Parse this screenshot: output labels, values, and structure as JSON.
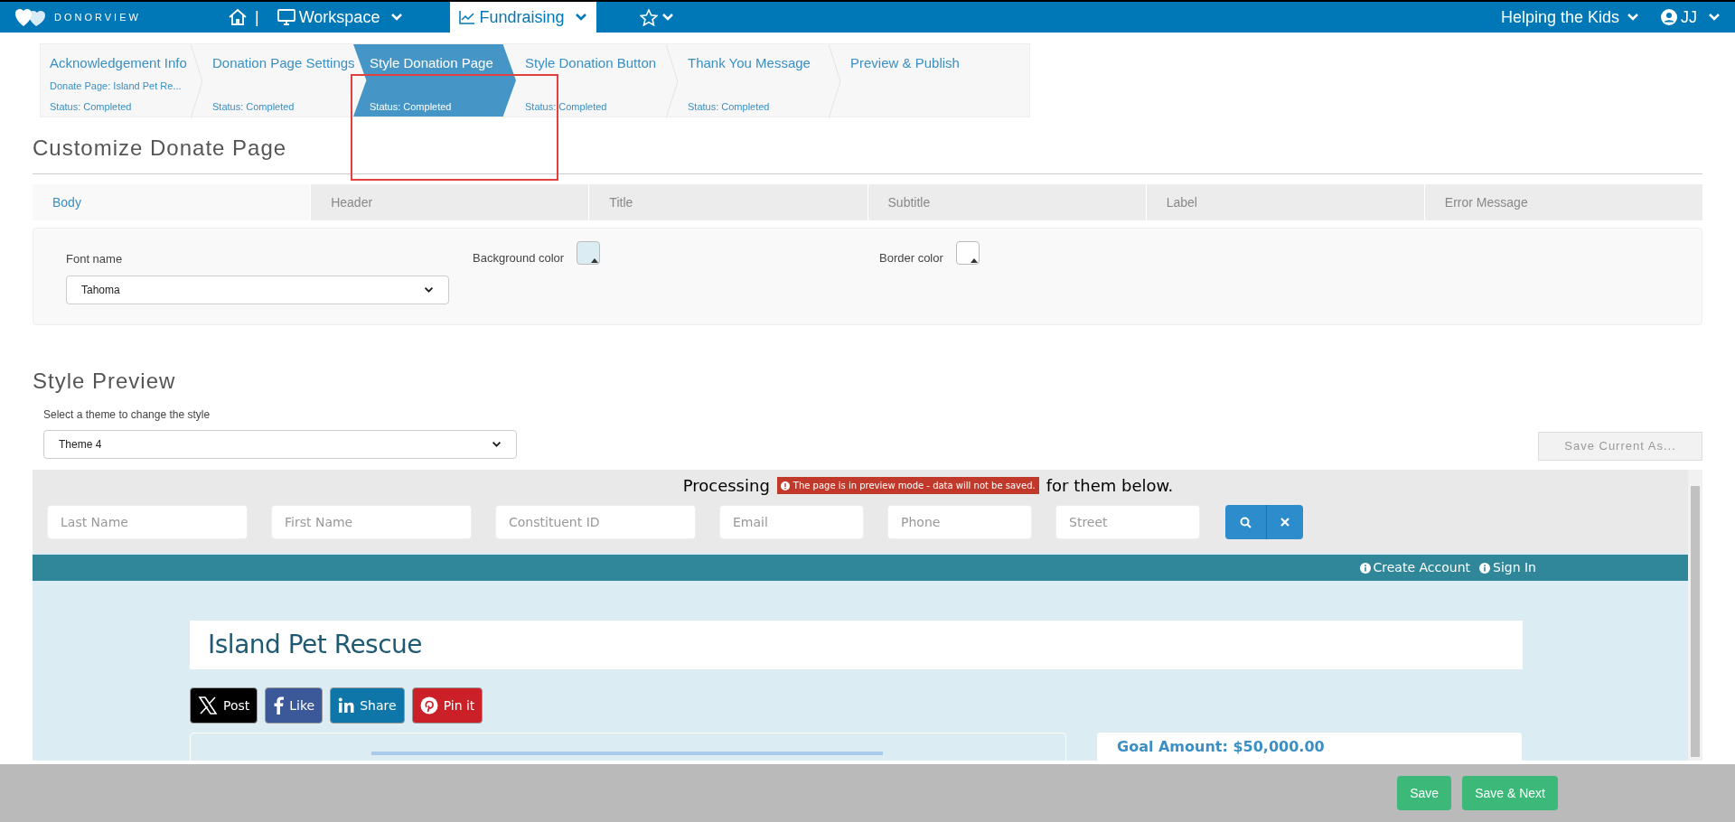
{
  "top_nav": {
    "brand": "DONORVIEW",
    "separator": "|",
    "items": [
      {
        "label": "Workspace",
        "kind": "monitor",
        "selected": false
      },
      {
        "label": "Fundraising",
        "kind": "chart",
        "selected": true
      }
    ],
    "organization": "Helping the Kids",
    "user": "JJ"
  },
  "wizard": [
    {
      "title": "Acknowledgement Info",
      "subtitle": "Donate Page: Island Pet Re...",
      "status": "Status: Completed",
      "selected": false
    },
    {
      "title": "Donation Page Settings",
      "status": "Status: Completed",
      "selected": false
    },
    {
      "title": "Style Donation Page",
      "status": "Status: Completed",
      "selected": true
    },
    {
      "title": "Style Donation Button",
      "status": "Status: Completed",
      "selected": false
    },
    {
      "title": "Thank You Message",
      "status": "Status: Completed",
      "selected": false
    },
    {
      "title": "Preview & Publish",
      "selected": false
    }
  ],
  "heading": "Customize Donate Page",
  "tabs": [
    {
      "label": "Body",
      "selected": true
    },
    {
      "label": "Header",
      "selected": false
    },
    {
      "label": "Title",
      "selected": false
    },
    {
      "label": "Subtitle",
      "selected": false
    },
    {
      "label": "Label",
      "selected": false
    },
    {
      "label": "Error Message",
      "selected": false
    }
  ],
  "body_settings": {
    "font_label": "Font name",
    "font_value": "Tahoma",
    "background_label": "Background color",
    "border_label": "Border color"
  },
  "style_preview": {
    "heading": "Style Preview",
    "theme_label": "Select a theme to change the style",
    "theme_value": "Theme 4",
    "save_as_button": "Save Current As...",
    "search_intro_start": "Processing",
    "search_intro_end": "for them below.",
    "preview_badge": "The page is in preview mode - data will not be saved.",
    "search_fields": [
      {
        "placeholder": "Last Name"
      },
      {
        "placeholder": "First Name"
      },
      {
        "placeholder": "Constituent ID"
      },
      {
        "placeholder": "Email"
      },
      {
        "placeholder": "Phone"
      },
      {
        "placeholder": "Street"
      }
    ],
    "account_links": [
      "Create Account",
      "Sign In"
    ],
    "page_title": "Island Pet Rescue",
    "social_buttons": [
      {
        "kind": "x",
        "label": "Post"
      },
      {
        "kind": "facebook",
        "label": "Like"
      },
      {
        "kind": "linkedin",
        "label": "Share"
      },
      {
        "kind": "pinterest",
        "label": "Pin it"
      }
    ],
    "goal": "Goal Amount: $50,000.00"
  },
  "footer_buttons": [
    "Save",
    "Save & Next"
  ]
}
